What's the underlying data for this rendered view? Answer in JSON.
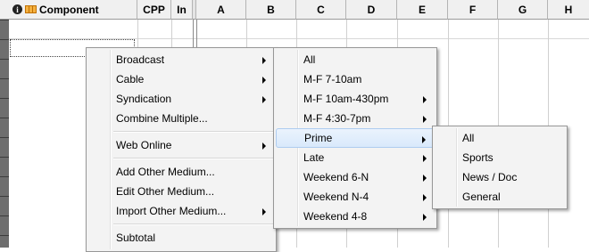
{
  "grid": {
    "left_headers": {
      "component": "Component",
      "cpp": "CPP",
      "in": "In"
    },
    "columns": [
      "A",
      "B",
      "C",
      "D",
      "E",
      "F",
      "G",
      "H"
    ]
  },
  "context_menu": {
    "items": [
      {
        "label": "Broadcast",
        "submenu": true,
        "highlighted": false
      },
      {
        "label": "Cable",
        "submenu": true
      },
      {
        "label": "Syndication",
        "submenu": true
      },
      {
        "label": "Combine Multiple...",
        "submenu": false
      },
      {
        "label": "Web Online",
        "submenu": true
      },
      {
        "label": "Add Other Medium...",
        "submenu": false
      },
      {
        "label": "Edit Other Medium...",
        "submenu": false
      },
      {
        "label": "Import Other Medium...",
        "submenu": true
      },
      {
        "label": "Subtotal",
        "submenu": false
      }
    ]
  },
  "broadcast_menu": {
    "items": [
      {
        "label": "All",
        "submenu": false
      },
      {
        "label": "M-F 7-10am",
        "submenu": false
      },
      {
        "label": "M-F 10am-430pm",
        "submenu": true
      },
      {
        "label": "M-F 4:30-7pm",
        "submenu": true
      },
      {
        "label": "Prime",
        "submenu": true,
        "highlighted": true
      },
      {
        "label": "Late",
        "submenu": true
      },
      {
        "label": "Weekend 6-N",
        "submenu": true
      },
      {
        "label": "Weekend N-4",
        "submenu": true
      },
      {
        "label": "Weekend 4-8",
        "submenu": true
      }
    ]
  },
  "prime_menu": {
    "items": [
      {
        "label": "All"
      },
      {
        "label": "Sports"
      },
      {
        "label": "News / Doc"
      },
      {
        "label": "General"
      }
    ]
  }
}
